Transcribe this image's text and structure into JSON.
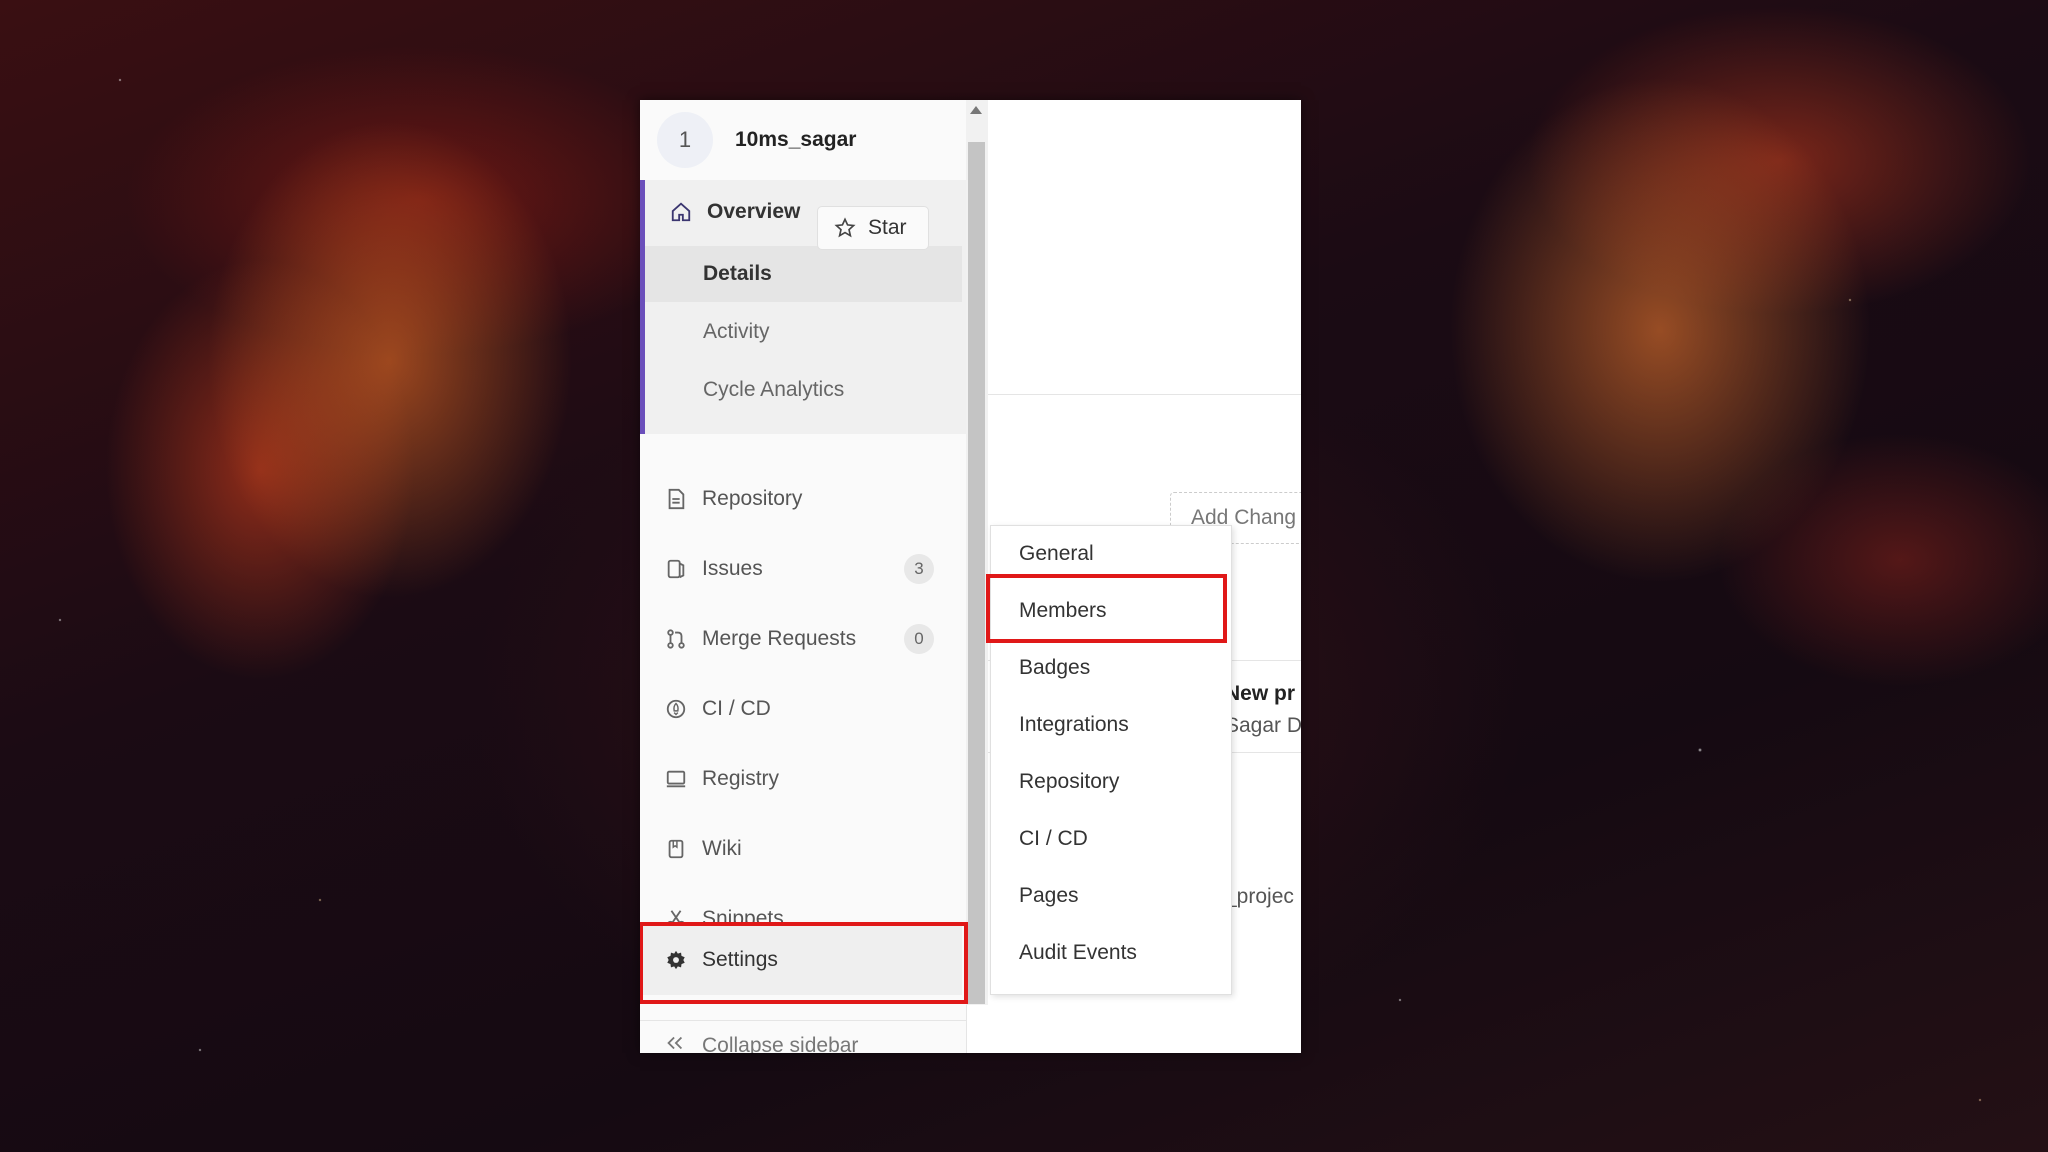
{
  "project": {
    "avatar_letter": "1",
    "name": "10ms_sagar"
  },
  "sidebar": {
    "overview": {
      "label": "Overview",
      "icon": "home-icon"
    },
    "sub_items": [
      {
        "label": "Details",
        "active": true
      },
      {
        "label": "Activity",
        "active": false
      },
      {
        "label": "Cycle Analytics",
        "active": false
      }
    ],
    "items": [
      {
        "label": "Repository",
        "icon": "document-icon"
      },
      {
        "label": "Issues",
        "icon": "issues-icon",
        "badge": "3"
      },
      {
        "label": "Merge Requests",
        "icon": "merge-request-icon",
        "badge": "0"
      },
      {
        "label": "CI / CD",
        "icon": "rocket-icon"
      },
      {
        "label": "Registry",
        "icon": "registry-icon"
      },
      {
        "label": "Wiki",
        "icon": "book-icon"
      },
      {
        "label": "Snippets",
        "icon": "scissors-icon"
      },
      {
        "label": "Settings",
        "icon": "gear-icon"
      }
    ],
    "collapse_label": "Collapse sidebar"
  },
  "settings_flyout": {
    "items": [
      "General",
      "Members",
      "Badges",
      "Integrations",
      "Repository",
      "CI / CD",
      "Pages",
      "Audit Events"
    ]
  },
  "main": {
    "star_label": "Star",
    "add_changelog_label": "Add Chang",
    "commit_title": "New pr",
    "commit_author": "Sagar D",
    "project_snippet": "_projec"
  },
  "colors": {
    "accent": "#6b4fbb",
    "highlight": "#e01818"
  }
}
